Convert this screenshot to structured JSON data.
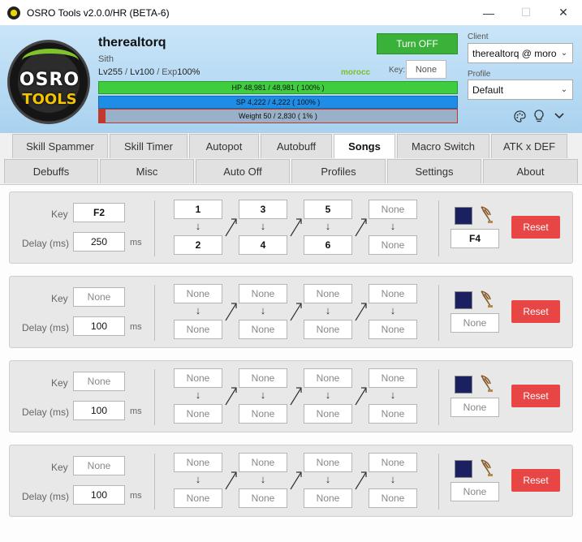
{
  "window": {
    "title": "OSRO Tools v2.0.0/HR (BETA-6)",
    "minimize": "—",
    "maximize": "☐",
    "close": "✕"
  },
  "logo": {
    "line1": "OSRO",
    "line2": "TOOLS"
  },
  "character": {
    "name": "therealtorq",
    "class": "Sith",
    "level_base": "Lv255",
    "sep1": " / ",
    "level_job": "Lv100",
    "sep2": " / Exp",
    "exp": "100%",
    "server": "morocc"
  },
  "toggle": {
    "label": "Turn OFF",
    "color": "#3ab23a"
  },
  "key": {
    "label": "Key:",
    "value": "None"
  },
  "bars": {
    "hp": {
      "text": "HP  48,981  /  48,981  ( 100% )",
      "ratio": 1.0
    },
    "sp": {
      "text": "SP  4,222  /  4,222  ( 100% )",
      "ratio": 1.0
    },
    "weight": {
      "text": "Weight  50  /  2,830  ( 1% )",
      "ratio": 0.01
    }
  },
  "client": {
    "label": "Client",
    "value": "therealtorq @ moro"
  },
  "profile": {
    "label": "Profile",
    "value": "Default"
  },
  "header_icons": [
    "palette-icon",
    "lightbulb-icon",
    "chevron-down-icon"
  ],
  "tabs_row1": [
    {
      "label": "Skill Spammer"
    },
    {
      "label": "Skill Timer"
    },
    {
      "label": "Autopot"
    },
    {
      "label": "Autobuff"
    },
    {
      "label": "Songs",
      "active": true
    },
    {
      "label": "Macro Switch"
    },
    {
      "label": "ATK x DEF"
    }
  ],
  "tabs_row2": [
    {
      "label": "Debuffs"
    },
    {
      "label": "Misc"
    },
    {
      "label": "Auto Off"
    },
    {
      "label": "Profiles"
    },
    {
      "label": "Settings"
    },
    {
      "label": "About"
    }
  ],
  "songs": {
    "key_label": "Key",
    "delay_label": "Delay (ms)",
    "ms_unit": "ms",
    "reset_label": "Reset",
    "arrow": "↓",
    "rows": [
      {
        "key": "F2",
        "delay": "250",
        "keys": [
          "1",
          "2",
          "3",
          "4",
          "5",
          "6",
          "None",
          "None"
        ],
        "trigger": "F4"
      },
      {
        "key": "None",
        "delay": "100",
        "keys": [
          "None",
          "None",
          "None",
          "None",
          "None",
          "None",
          "None",
          "None"
        ],
        "trigger": "None"
      },
      {
        "key": "None",
        "delay": "100",
        "keys": [
          "None",
          "None",
          "None",
          "None",
          "None",
          "None",
          "None",
          "None"
        ],
        "trigger": "None"
      },
      {
        "key": "None",
        "delay": "100",
        "keys": [
          "None",
          "None",
          "None",
          "None",
          "None",
          "None",
          "None",
          "None"
        ],
        "trigger": "None"
      }
    ]
  },
  "colors": {
    "reset": "#e84545",
    "hp": "#3fcd3f",
    "sp": "#1e8de6",
    "weight": "#98b0c8",
    "header": "#b9dcf4"
  }
}
